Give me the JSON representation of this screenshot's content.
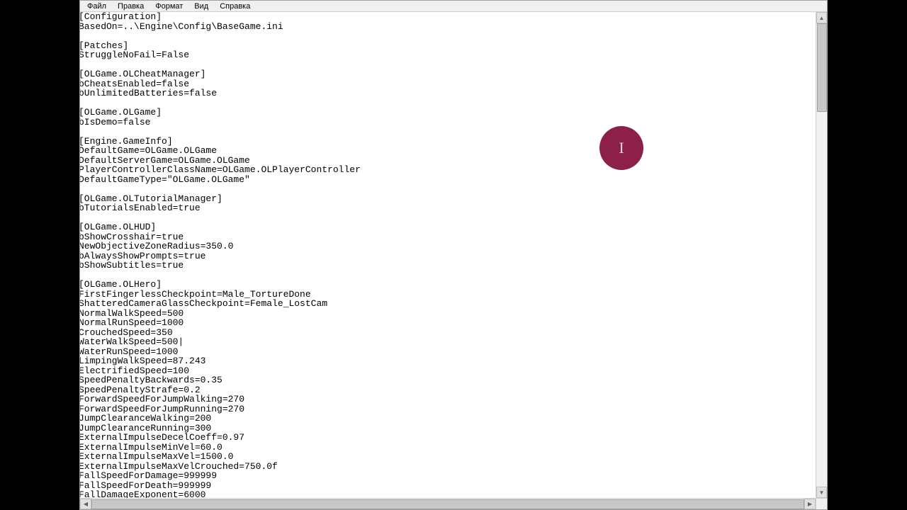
{
  "menu": {
    "items": [
      "Файл",
      "Правка",
      "Формат",
      "Вид",
      "Справка"
    ]
  },
  "badge": {
    "glyph": "I"
  },
  "file_text": "[Configuration]\nBasedOn=..\\Engine\\Config\\BaseGame.ini\n\n[Patches]\nStruggleNoFail=False\n\n[OLGame.OLCheatManager]\nbCheatsEnabled=false\nbUnlimitedBatteries=false\n\n[OLGame.OLGame]\nbIsDemo=false\n\n[Engine.GameInfo]\nDefaultGame=OLGame.OLGame\nDefaultServerGame=OLGame.OLGame\nPlayerControllerClassName=OLGame.OLPlayerController\nDefaultGameType=\"OLGame.OLGame\"\n\n[OLGame.OLTutorialManager]\nbTutorialsEnabled=true\n\n[OLGame.OLHUD]\nbShowCrosshair=true\nNewObjectiveZoneRadius=350.0\nbAlwaysShowPrompts=true\nbShowSubtitles=true\n\n[OLGame.OLHero]\nFirstFingerlessCheckpoint=Male_TortureDone\nShatteredCameraGlassCheckpoint=Female_LostCam\nNormalWalkSpeed=500\nNormalRunSpeed=1000\nCrouchedSpeed=350\nWaterWalkSpeed=500|\nWaterRunSpeed=1000\nLimpingWalkSpeed=87.243\nElectrifiedSpeed=100\nSpeedPenaltyBackwards=0.35\nSpeedPenaltyStrafe=0.2\nForwardSpeedForJumpWalking=270\nForwardSpeedForJumpRunning=270\nJumpClearanceWalking=200\nJumpClearanceRunning=300\nExternalImpulseDecelCoeff=0.97\nExternalImpulseMinVel=60.0\nExternalImpulseMaxVel=1500.0\nExternalImpulseMaxVelCrouched=750.0f\nFallSpeedForDamage=999999\nFallSpeedForDeath=999999\nFallDamageExponent=6000"
}
